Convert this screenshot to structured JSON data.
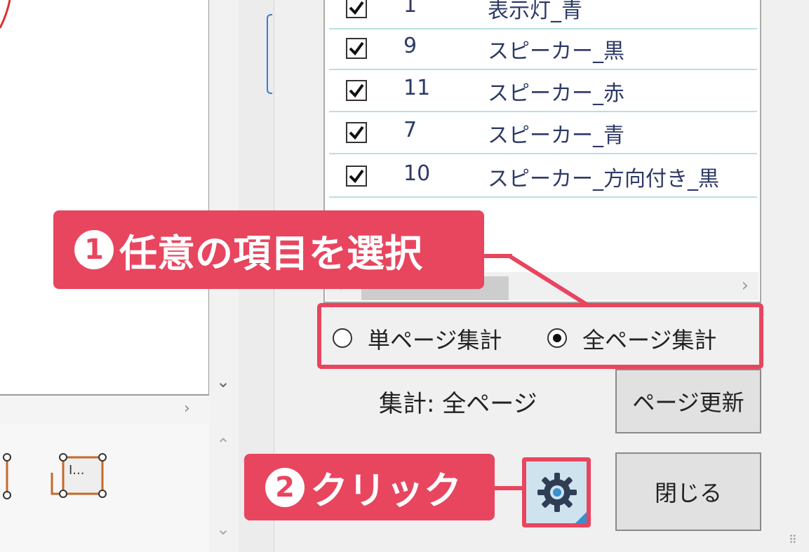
{
  "list": {
    "rows": [
      {
        "checked": true,
        "number": "1",
        "name": "表示灯_青"
      },
      {
        "checked": true,
        "number": "9",
        "name": "スピーカー_黒"
      },
      {
        "checked": true,
        "number": "11",
        "name": "スピーカー_赤"
      },
      {
        "checked": true,
        "number": "7",
        "name": "スピーカー_青"
      },
      {
        "checked": true,
        "number": "10",
        "name": "スピーカー_方向付き_黒"
      }
    ]
  },
  "radio": {
    "single_page": "単ページ集計",
    "all_pages": "全ページ集計",
    "selected": "all_pages"
  },
  "summary": "集計: 全ページ",
  "buttons": {
    "page_update": "ページ更新",
    "close": "閉じる"
  },
  "callouts": {
    "step1_number": "1",
    "step1_text": "任意の項目を選択",
    "step2_number": "2",
    "step2_text": "クリック"
  },
  "toolbar": {
    "text_box_tool_label": "I..."
  },
  "colors": {
    "accent": "#e8455f",
    "row_divider": "#b9dfe6",
    "text_blue": "#2d3a66"
  },
  "icons": {
    "gear": "gear-icon",
    "checkbox": "checkmark-icon",
    "scroll_left": "chevron-left-icon",
    "scroll_right": "chevron-right-icon"
  }
}
